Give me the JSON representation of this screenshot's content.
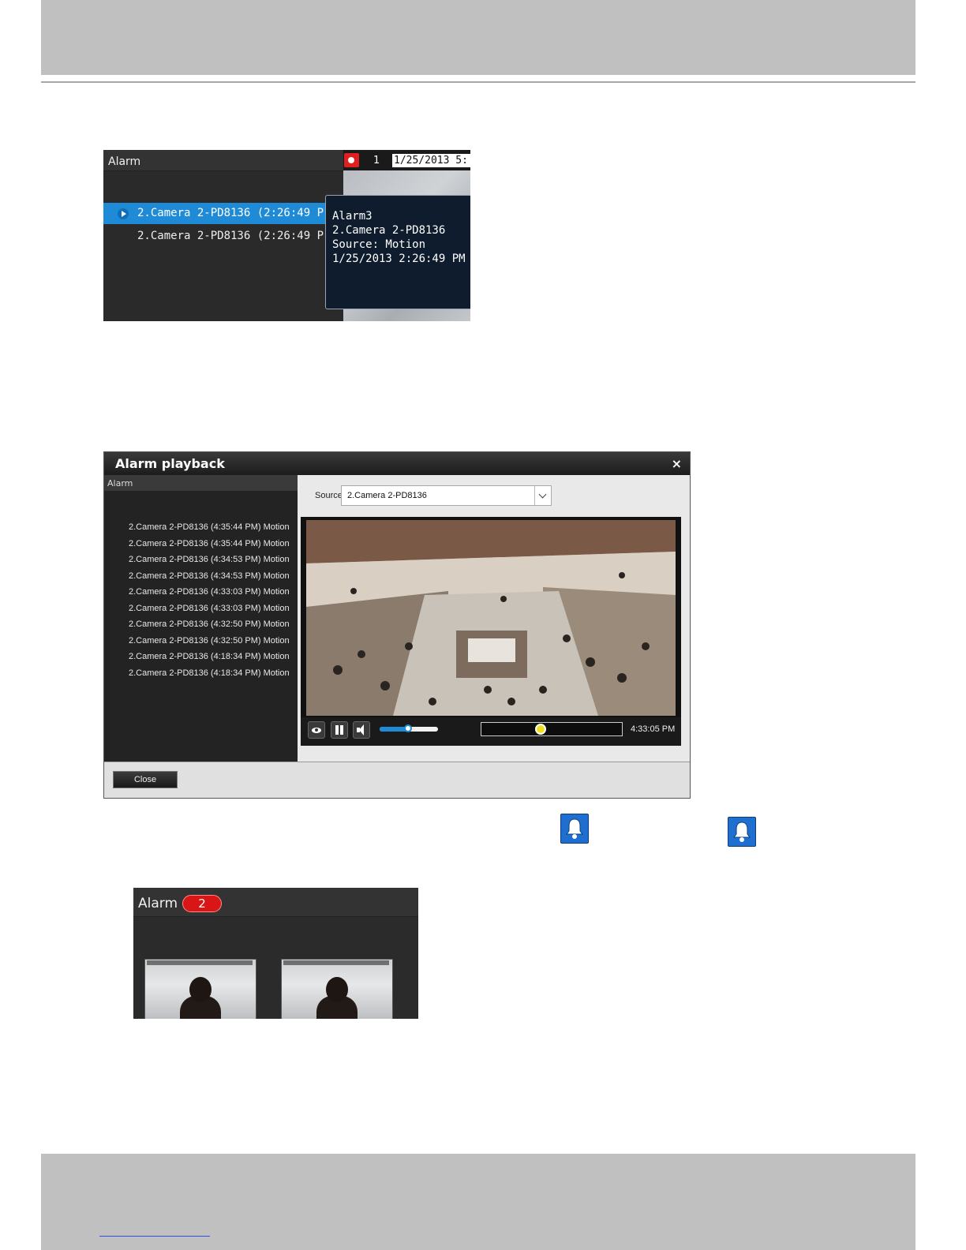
{
  "shot1": {
    "panel_title": "Alarm",
    "channel_number": "1",
    "timestamp": "1/25/2013 5:",
    "alarm_rows": [
      "2.Camera 2-PD8136 (2:26:49 P",
      "2.Camera 2-PD8136 (2:26:49 P..."
    ],
    "tooltip": {
      "line1": "Alarm3",
      "line2": "2.Camera 2-PD8136",
      "line3": "Source: Motion",
      "line4": "1/25/2013 2:26:49 PM"
    }
  },
  "shot2": {
    "title": "Alarm playback",
    "close_symbol": "×",
    "left_title": "Alarm",
    "alarm_items": [
      "2.Camera 2-PD8136 (4:35:44 PM) Motion",
      "2.Camera 2-PD8136 (4:35:44 PM) Motion",
      "2.Camera 2-PD8136 (4:34:53 PM) Motion",
      "2.Camera 2-PD8136 (4:34:53 PM) Motion",
      "2.Camera 2-PD8136 (4:33:03 PM) Motion",
      "2.Camera 2-PD8136 (4:33:03 PM) Motion",
      "2.Camera 2-PD8136 (4:32:50 PM) Motion",
      "2.Camera 2-PD8136 (4:32:50 PM) Motion",
      "2.Camera 2-PD8136 (4:18:34 PM) Motion",
      "2.Camera 2-PD8136 (4:18:34 PM) Motion"
    ],
    "source_label": "Source",
    "source_value": "2.Camera 2-PD8136",
    "time": "4:33:05 PM",
    "volume_fraction": 0.48,
    "playback_fraction": 0.42,
    "close_button": "Close"
  },
  "shot3": {
    "title": "Alarm",
    "count": "2"
  },
  "colors": {
    "selection_blue": "#1f8ad6",
    "record_red": "#e02020",
    "badge_red": "#d91515",
    "bell_blue": "#1f6fd0"
  },
  "icons": [
    "record-icon",
    "play-icon",
    "eye-icon",
    "pause-icon",
    "volume-icon",
    "bell-icon",
    "chevron-down-icon"
  ]
}
